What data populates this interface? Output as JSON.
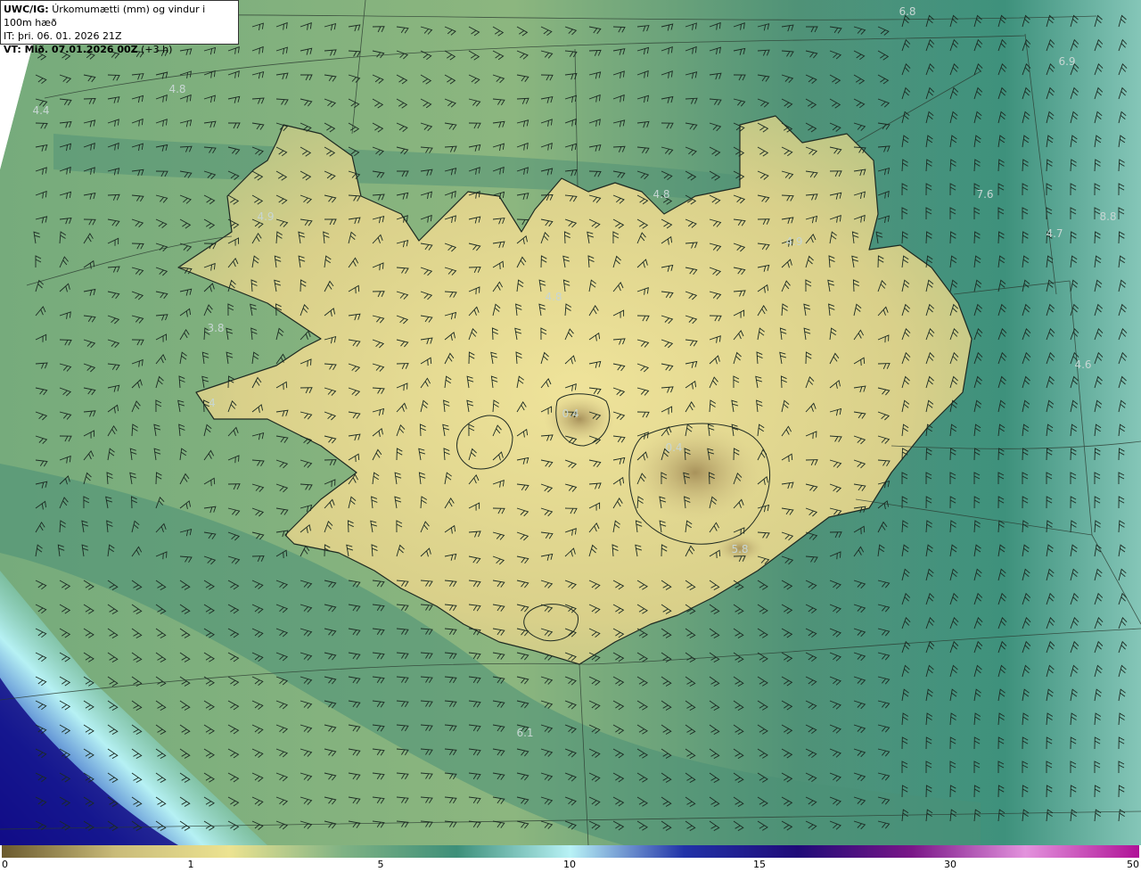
{
  "info": {
    "model": "UWC/IG:",
    "title": "Úrkomumætti (mm) og vindur i 100m hæð",
    "it_line": "IT: þri. 06. 01. 2026 21Z",
    "vt_label": "VT: Mið. 07.01.2026 00Z",
    "vt_offset": "(+3 h)"
  },
  "map_labels": [
    "6.8",
    "6.9",
    "4.8",
    "4.4",
    "4.8",
    "7.6",
    "4.7",
    "8.8",
    "4.6",
    "4.9",
    "4.8",
    "4.9",
    "3.8",
    "4",
    "0.4",
    "0.4",
    "5.8",
    "6.1"
  ],
  "legend": {
    "labels": [
      "0",
      "1",
      "5",
      "10",
      "15",
      "30",
      "50"
    ],
    "colors": [
      "#6b5a2e",
      "#c9bb79",
      "#ece391",
      "#7fb284",
      "#3d8f79",
      "#b8f2f6",
      "#2132a8",
      "#1f0a78",
      "#7a1688",
      "#e392dd",
      "#b01197"
    ]
  },
  "palette": {
    "land_yellow": "#e9dc8e",
    "sea_green": "#4f9277",
    "deep_sea": "#3c8a78",
    "heavy_blue": "#0d0e8c"
  }
}
